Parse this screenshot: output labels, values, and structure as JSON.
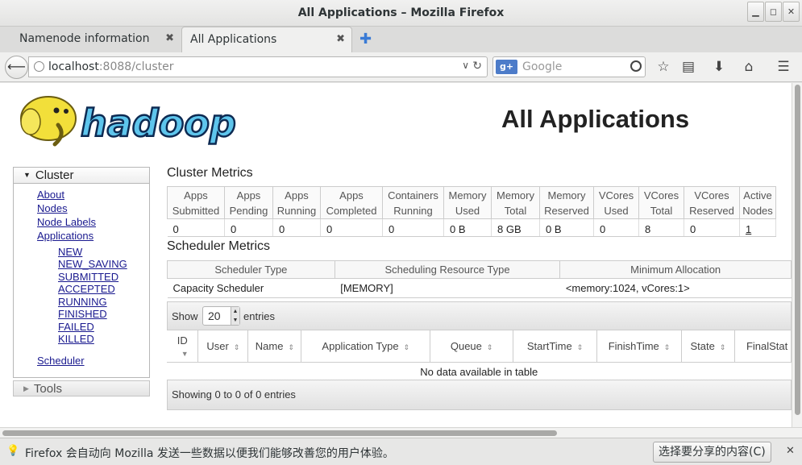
{
  "window": {
    "title": "All Applications – Mozilla Firefox"
  },
  "tabs": [
    {
      "label": "Namenode information"
    },
    {
      "label": "All Applications"
    }
  ],
  "navbar": {
    "url_host": "localhost",
    "url_rest": ":8088/cluster",
    "search_placeholder": "Google",
    "search_engine_badge": "g+"
  },
  "page": {
    "title": "All Applications",
    "logo_text": "hadoop"
  },
  "sidebar": {
    "cluster_label": "Cluster",
    "links": [
      "About",
      "Nodes",
      "Node Labels",
      "Applications"
    ],
    "app_states": [
      "NEW",
      "NEW_SAVING",
      "SUBMITTED",
      "ACCEPTED",
      "RUNNING",
      "FINISHED",
      "FAILED",
      "KILLED"
    ],
    "scheduler": "Scheduler",
    "tools_label": "Tools"
  },
  "cluster_metrics": {
    "title": "Cluster Metrics",
    "headers": [
      [
        "Apps",
        "Submitted"
      ],
      [
        "Apps",
        "Pending"
      ],
      [
        "Apps",
        "Running"
      ],
      [
        "Apps",
        "Completed"
      ],
      [
        "Containers",
        "Running"
      ],
      [
        "Memory",
        "Used"
      ],
      [
        "Memory",
        "Total"
      ],
      [
        "Memory",
        "Reserved"
      ],
      [
        "VCores",
        "Used"
      ],
      [
        "VCores",
        "Total"
      ],
      [
        "VCores",
        "Reserved"
      ],
      [
        "Active",
        "Nodes"
      ]
    ],
    "values": [
      "0",
      "0",
      "0",
      "0",
      "0",
      "0 B",
      "8 GB",
      "0 B",
      "0",
      "8",
      "0",
      "1"
    ]
  },
  "scheduler_metrics": {
    "title": "Scheduler Metrics",
    "headers": [
      "Scheduler Type",
      "Scheduling Resource Type",
      "Minimum Allocation"
    ],
    "values": [
      "Capacity Scheduler",
      "[MEMORY]",
      "<memory:1024, vCores:1>"
    ]
  },
  "apps_table": {
    "show_label": "Show",
    "page_size": "20",
    "entries_label": "entries",
    "columns": [
      "ID",
      "User",
      "Name",
      "Application Type",
      "Queue",
      "StartTime",
      "FinishTime",
      "State",
      "FinalStat"
    ],
    "empty_message": "No data available in table",
    "footer": "Showing 0 to 0 of 0 entries"
  },
  "notification": {
    "message": "Firefox 会自动向 Mozilla 发送一些数据以便我们能够改善您的用户体验。",
    "share_button": "选择要分享的内容(C)"
  }
}
